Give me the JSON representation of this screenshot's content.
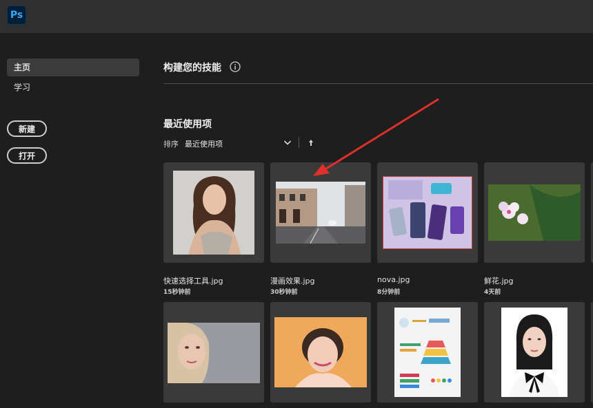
{
  "app": {
    "logo": "Ps",
    "icon": "photoshop-logo-icon"
  },
  "sidebar": {
    "items": [
      {
        "label": "主页",
        "active": true
      },
      {
        "label": "学习",
        "active": false
      }
    ],
    "new_button": "新建",
    "open_button": "打开"
  },
  "main": {
    "title": "构建您的技能",
    "info_icon": "info-icon",
    "recent": {
      "title": "最近使用项",
      "sort_label": "排序",
      "sort_value": "最近使用项",
      "sort_icon": "chevron-down-icon",
      "sort_direction_icon": "arrow-up-icon"
    },
    "files": [
      {
        "name": "快速选择工具.jpg",
        "time": "15秒钟前"
      },
      {
        "name": "漫画效果.jpg",
        "time": "30秒钟前"
      },
      {
        "name": "nova.jpg",
        "time": "8分钟前"
      },
      {
        "name": "鲜花.jpg",
        "time": "4天前"
      }
    ]
  },
  "annotation": {
    "color": "#e0302a",
    "icon": "red-arrow-annotation"
  }
}
